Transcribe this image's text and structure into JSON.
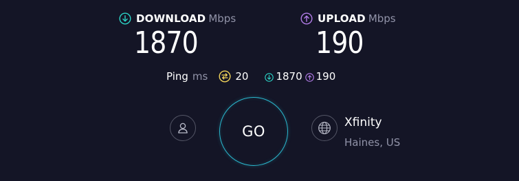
{
  "download": {
    "label": "DOWNLOAD",
    "unit": "Mbps",
    "value": "1870",
    "icon": "download-arrow-circle-icon",
    "color": "#2bd3c6"
  },
  "upload": {
    "label": "UPLOAD",
    "unit": "Mbps",
    "value": "190",
    "icon": "upload-arrow-circle-icon",
    "color": "#b27ce8"
  },
  "ping": {
    "label": "Ping",
    "unit": "ms",
    "idle_value": "20",
    "download_value": "1870",
    "upload_value": "190",
    "idle_color": "#f3d55a"
  },
  "go_button": {
    "label": "GO",
    "ring_color": "#2bb9cf"
  },
  "provider": {
    "name": "Xfinity",
    "location": "Haines, US"
  },
  "colors": {
    "background": "#141526",
    "muted_text": "#9193a8"
  }
}
